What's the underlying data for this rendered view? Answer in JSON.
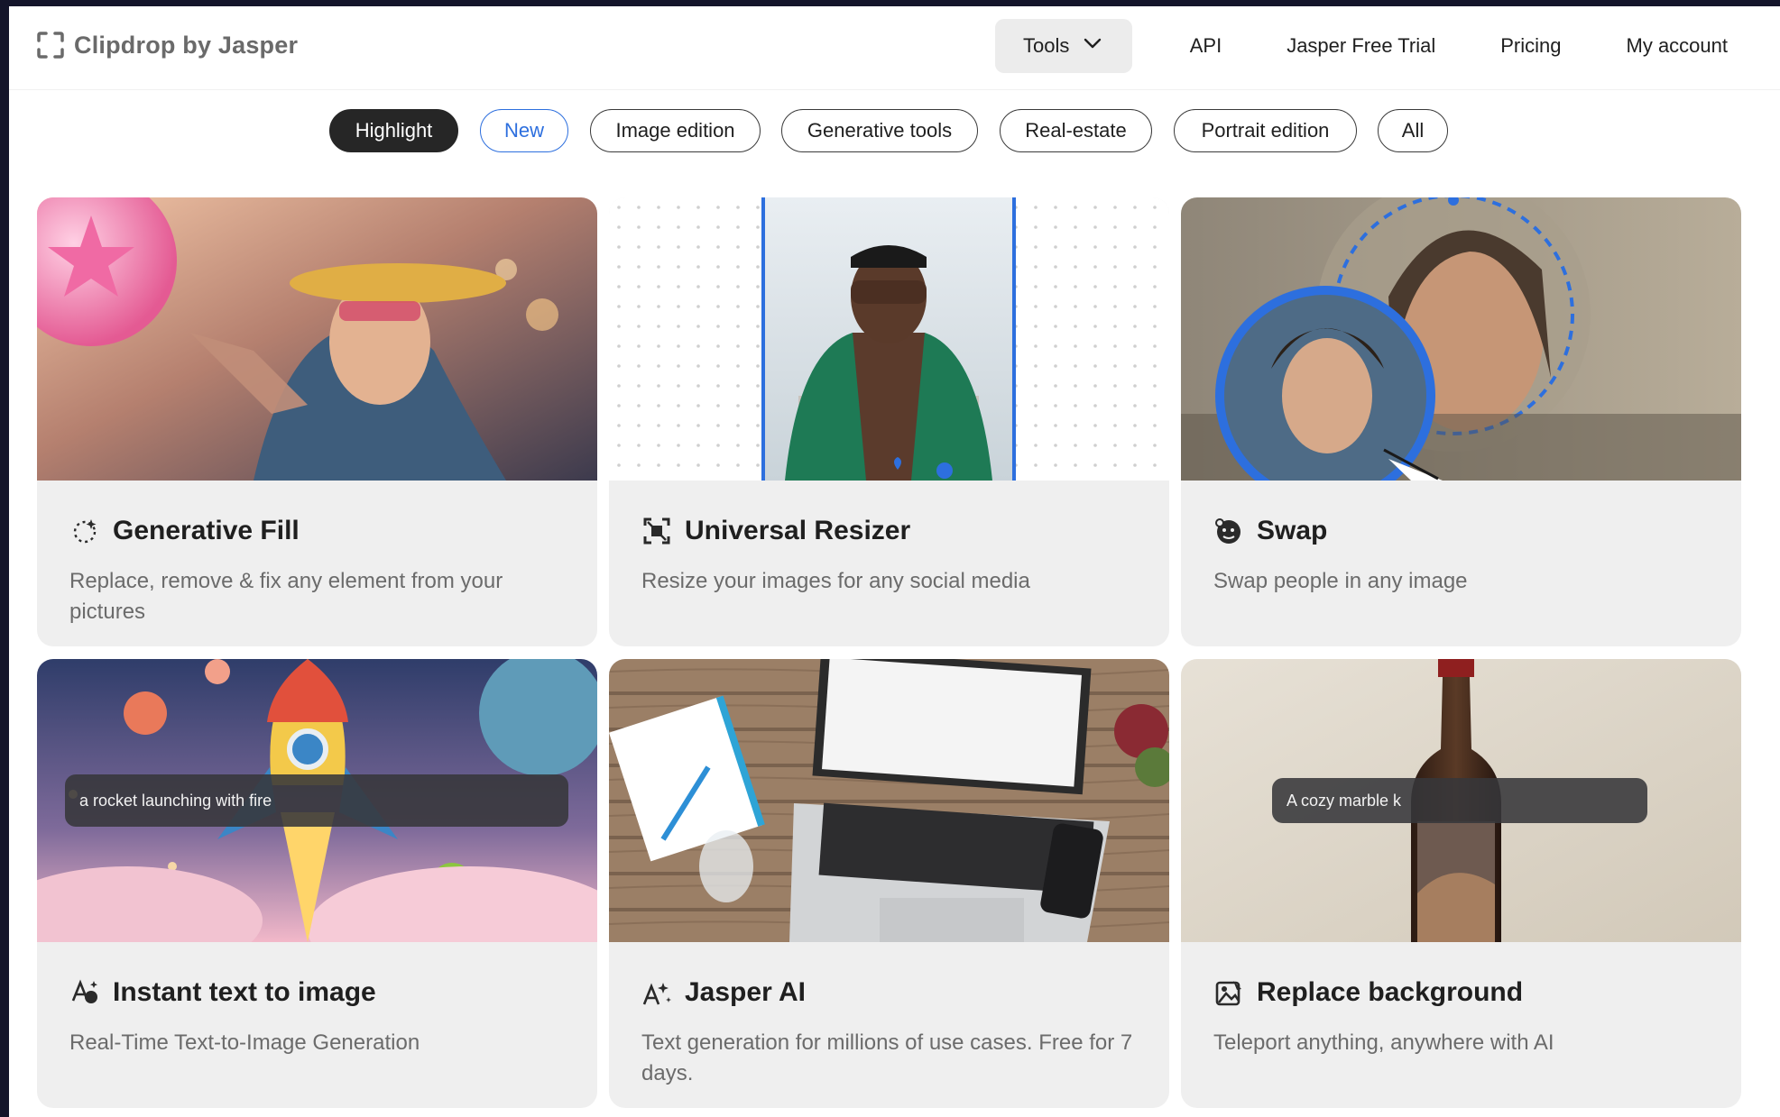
{
  "header": {
    "brand": "Clipdrop by Jasper",
    "nav": {
      "tools": "Tools",
      "api": "API",
      "trial": "Jasper Free Trial",
      "pricing": "Pricing",
      "account": "My account"
    }
  },
  "filters": [
    "Highlight",
    "New",
    "Image edition",
    "Generative tools",
    "Real-estate",
    "Portrait edition",
    "All"
  ],
  "active_filter": "Highlight",
  "cards": [
    {
      "title": "Generative Fill",
      "description": "Replace, remove & fix any element from your pictures",
      "icon": "sparkle-dashed-icon"
    },
    {
      "title": "Universal Resizer",
      "description": "Resize your images for any social media",
      "icon": "resize-frame-icon"
    },
    {
      "title": "Swap",
      "description": "Swap people in any image",
      "icon": "face-swap-icon"
    },
    {
      "title": "Instant text to image",
      "description": "Real-Time Text-to-Image Generation",
      "icon": "text-to-image-icon",
      "prompt": "a rocket launching with fire"
    },
    {
      "title": "Jasper AI",
      "description": "Text generation for millions of use cases. Free for 7 days.",
      "icon": "ai-text-icon"
    },
    {
      "title": "Replace background",
      "description": "Teleport anything, anywhere with AI",
      "icon": "replace-background-icon",
      "prompt": "A cozy marble k"
    }
  ],
  "colors": {
    "accent_blue": "#2d6fde",
    "chip_active": "#262626",
    "card_bg": "#efefef"
  }
}
